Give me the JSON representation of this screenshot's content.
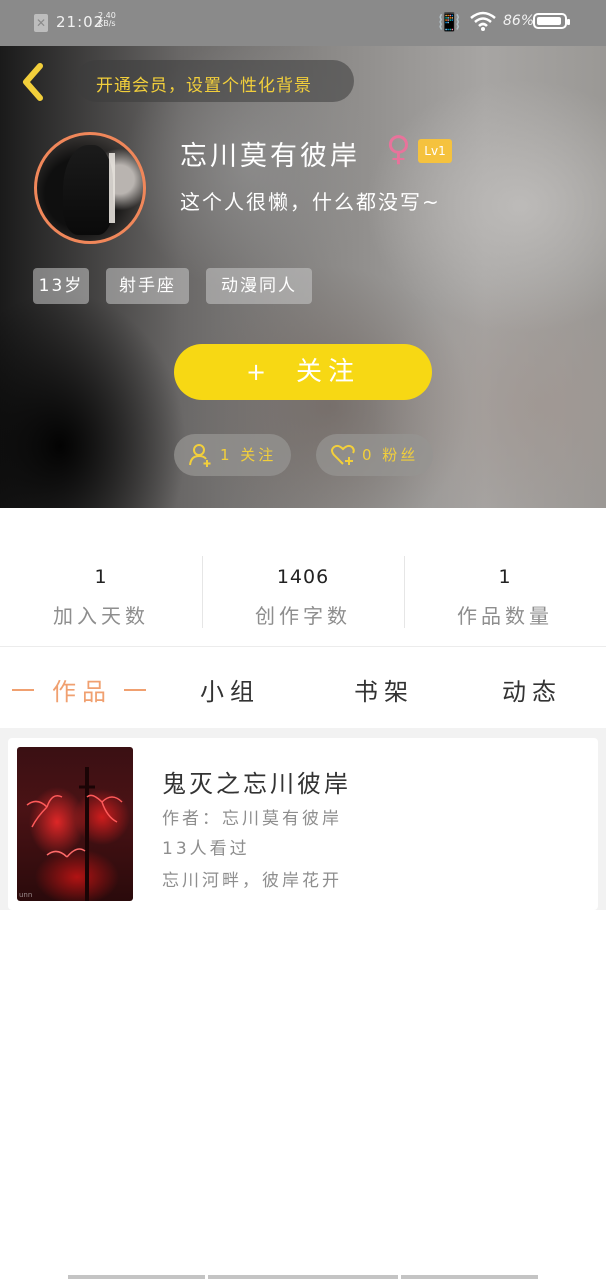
{
  "status_bar": {
    "time": "21:02",
    "net_speed_value": "2.40",
    "net_speed_unit": "KB/s",
    "battery": "86%",
    "battery_level": 0.86
  },
  "header": {
    "back_icon": "chevron-left-icon",
    "vip_banner": "开通会员，设置个性化背景"
  },
  "profile": {
    "avatar_icon": "avatar",
    "name": "忘川莫有彼岸",
    "gender_symbol": "♀",
    "level": "Lv1",
    "signature": "这个人很懒，什么都没写~",
    "tags": [
      "13岁",
      "射手座",
      "动漫同人"
    ],
    "follow_button": "关注",
    "follow_plus": "+",
    "following": "1 关注",
    "fans": "0 粉丝"
  },
  "stats": [
    {
      "value": "1",
      "label": "加入天数"
    },
    {
      "value": "1406",
      "label": "创作字数"
    },
    {
      "value": "1",
      "label": "作品数量"
    }
  ],
  "tabs": [
    "作品",
    "小组",
    "书架",
    "动态"
  ],
  "active_tab": "作品",
  "works": [
    {
      "title": "鬼灭之忘川彼岸",
      "author": "作者：忘川莫有彼岸",
      "views": "13人看过",
      "desc": "忘川河畔，彼岸花开",
      "cover_watermark": "unn"
    }
  ],
  "colors": {
    "accent_yellow": "#f7d814",
    "vip_text": "#f2cf3b",
    "active_tab": "#f0a070",
    "gender": "#e8739b",
    "level_badge": "#f5c23e"
  }
}
